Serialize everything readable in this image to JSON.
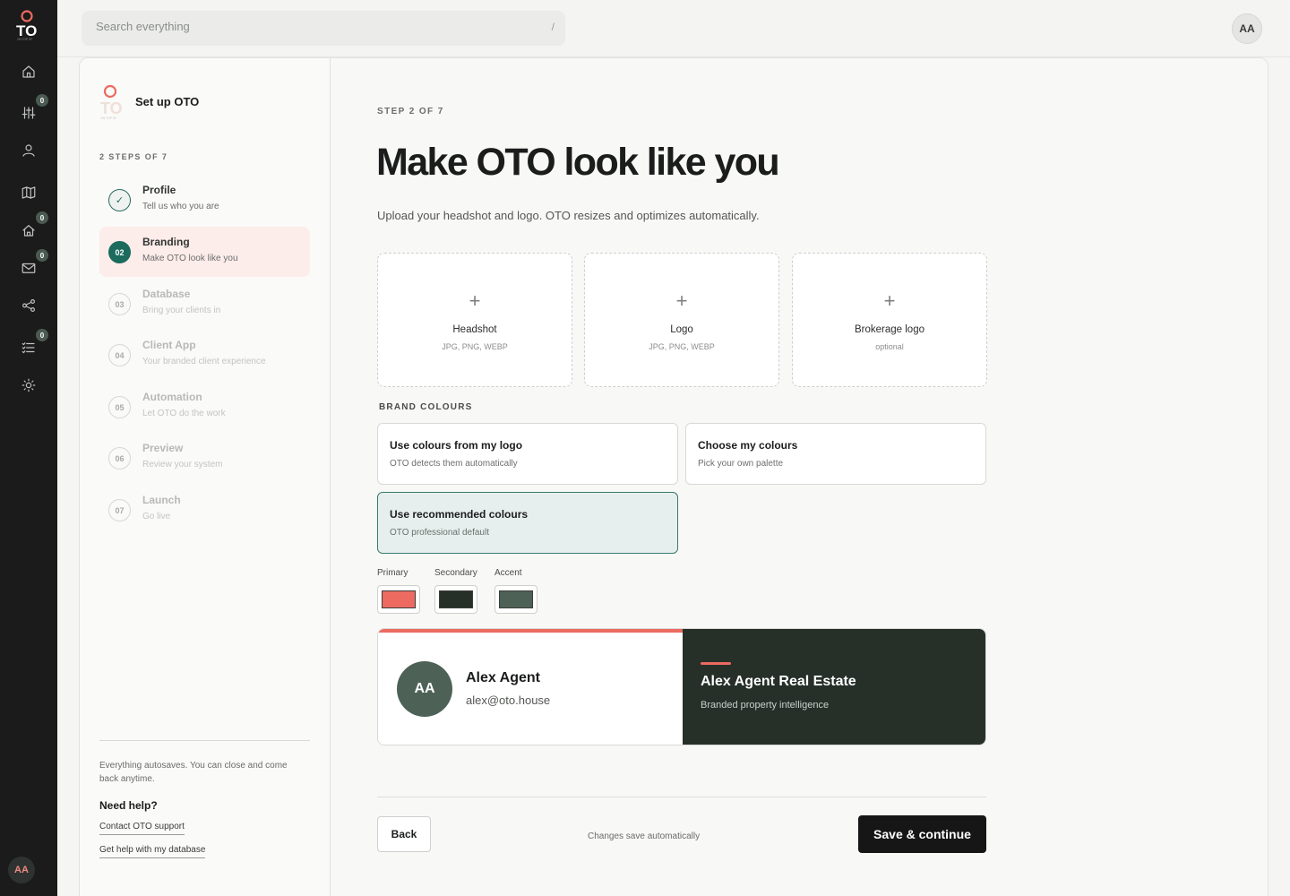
{
  "app": {
    "logo_text": "TO",
    "logo_tagline": "ON TOP OF"
  },
  "rail": {
    "items": [
      {
        "icon": "home-icon",
        "badge": null
      },
      {
        "icon": "sliders-icon",
        "badge": "0"
      },
      {
        "icon": "user-icon",
        "badge": null
      },
      {
        "icon": "map-icon",
        "badge": null
      },
      {
        "icon": "house-icon",
        "badge": "0"
      },
      {
        "icon": "mail-icon",
        "badge": "0"
      },
      {
        "icon": "share-icon",
        "badge": null
      },
      {
        "icon": "checklist-icon",
        "badge": "0"
      },
      {
        "icon": "settings-icon",
        "badge": null
      }
    ],
    "user_initials": "AA"
  },
  "topbar": {
    "search_placeholder": "Search everything",
    "search_shortcut": "/",
    "user_initials": "AA"
  },
  "sidebar": {
    "title": "Set up OTO",
    "progress_label": "2 STEPS OF 7",
    "steps": [
      {
        "number": "✓",
        "title": "Profile",
        "subtitle": "Tell us who you are",
        "state": "done"
      },
      {
        "number": "02",
        "title": "Branding",
        "subtitle": "Make OTO look like you",
        "state": "active"
      },
      {
        "number": "03",
        "title": "Database",
        "subtitle": "Bring your clients in",
        "state": "pending"
      },
      {
        "number": "04",
        "title": "Client App",
        "subtitle": "Your branded client experience",
        "state": "pending"
      },
      {
        "number": "05",
        "title": "Automation",
        "subtitle": "Let OTO do the work",
        "state": "pending"
      },
      {
        "number": "06",
        "title": "Preview",
        "subtitle": "Review your system",
        "state": "pending"
      },
      {
        "number": "07",
        "title": "Launch",
        "subtitle": "Go live",
        "state": "pending"
      }
    ],
    "autosave_note": "Everything autosaves. You can close and come back anytime.",
    "help_title": "Need help?",
    "help_links": [
      "Contact OTO support",
      "Get help with my database"
    ]
  },
  "main": {
    "step_label": "STEP 2 OF 7",
    "title": "Make OTO look like you",
    "description": "Upload your headshot and logo. OTO resizes and optimizes automatically.",
    "uploads": [
      {
        "title": "Headshot",
        "subtitle": "JPG, PNG, WEBP"
      },
      {
        "title": "Logo",
        "subtitle": "JPG, PNG, WEBP"
      },
      {
        "title": "Brokerage logo",
        "subtitle": "optional"
      }
    ],
    "brand_colours_label": "BRAND COLOURS",
    "colour_options": [
      {
        "title": "Use colours from my logo",
        "subtitle": "OTO detects them automatically",
        "selected": false
      },
      {
        "title": "Choose my colours",
        "subtitle": "Pick your own palette",
        "selected": false
      },
      {
        "title": "Use recommended colours",
        "subtitle": "OTO professional default",
        "selected": true
      }
    ],
    "swatches": [
      {
        "label": "Primary",
        "color": "#ec6a60"
      },
      {
        "label": "Secondary",
        "color": "#263029"
      },
      {
        "label": "Accent",
        "color": "#4d6156"
      }
    ],
    "preview": {
      "initials": "AA",
      "name": "Alex Agent",
      "email": "alex@oto.house",
      "brand_name": "Alex Agent Real Estate",
      "tagline": "Branded property intelligence"
    },
    "footer": {
      "back_label": "Back",
      "note": "Changes save automatically",
      "save_label": "Save & continue"
    }
  },
  "colors": {
    "accent_coral": "#ec6a60",
    "dark_green": "#263029",
    "teal": "#1c6b5d"
  }
}
